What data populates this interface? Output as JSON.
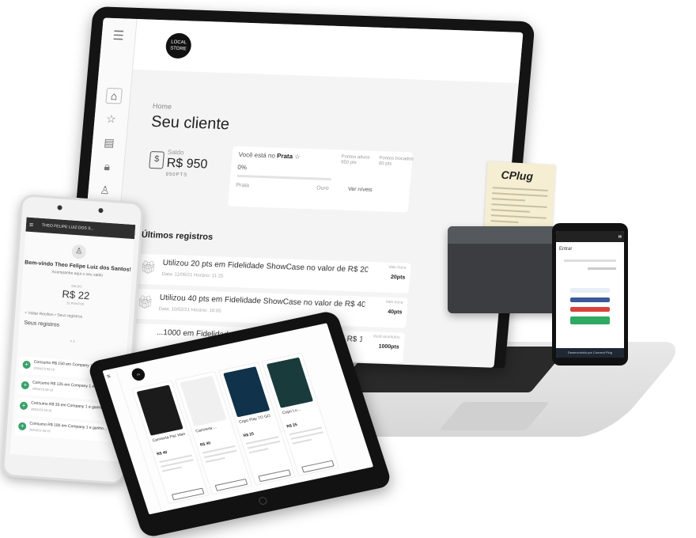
{
  "laptop": {
    "logo_line1": "LOCAL",
    "logo_line2": "STORE",
    "breadcrumb": "Home",
    "page_title": "Seu cliente",
    "balance": {
      "label": "Saldo",
      "value": "R$ 950",
      "points": "950PTS"
    },
    "tier": {
      "text_prefix": "Você está no",
      "current": "Prata",
      "progress_text": "0%",
      "progress_fraction": 0.0,
      "from": "Prata",
      "to": "Ouro",
      "points_info": "Pontos ativos\n950 pts",
      "points_used": "Pontos trocados\n00 pts",
      "link": "Ver níveis"
    },
    "section_title": "Últimos registros",
    "records": [
      {
        "desc": "Utilizou 20 pts em Fidelidade ShowCase no valor de R$ 20",
        "date": "Data: 11/06/21   Horário: 11:25",
        "kind": "Vale troca",
        "pts": "20pts"
      },
      {
        "desc": "Utilizou 40 pts em Fidelidade ShowCase no valor de R$ 40",
        "date": "Data: 10/02/21   Horário: 16:05",
        "kind": "Vale troca",
        "pts": "40pts"
      },
      {
        "desc": "...1000 em Fidelidade ShowCase e ganhou 1000 pts | R$ 1...",
        "date": "",
        "kind": "Você acumulou",
        "pts": "1000pts"
      }
    ]
  },
  "receipt": {
    "brand": "CPlug"
  },
  "phone_right": {
    "title": "Entrar",
    "footer": "Desenvolvido por Connect Plug"
  },
  "phone_left": {
    "header": "THEO FELIPE LUIZ DOS S...",
    "welcome": "Bem-vindo Theo Felipe Luiz dos Santos!",
    "subtitle": "Acompanhe aqui o seu saldo",
    "balance_label": "SALDO",
    "balance": "R$ 22",
    "points": "22 PONTOS",
    "nav": "< Voltar   Recibos  •  Seus registros",
    "section": "Seus registros",
    "pager": "‹  ›",
    "items": [
      {
        "text": "Consumo R$ 150 em Company 1 e ganho...",
        "date": "20/04/23 08:18"
      },
      {
        "text": "Consumo R$ 125 em Company 1 e ganho...",
        "date": "20/04/23 08:18"
      },
      {
        "text": "Consumo R$ 35 em Company 1 e ganho...",
        "date": "20/04/23 08:18"
      },
      {
        "text": "Consumo R$ 100 em Company 1 e ganho...",
        "date": "20/04/23 08:18"
      }
    ]
  },
  "tablet": {
    "products": [
      {
        "name": "Camiseta Pac Man",
        "price": "R$ 40",
        "color": "#1b1b1b"
      },
      {
        "name": "Camiseta ...",
        "price": "R$ 40",
        "color": "#f0f0f0"
      },
      {
        "name": "Copo Play TO GO",
        "price": "R$ 25",
        "color": "#10324a"
      },
      {
        "name": "Copo Lu...",
        "price": "R$ 25",
        "color": "#1a3b3c"
      }
    ]
  },
  "colors": {
    "accent_green": "#38a169",
    "dark": "#141414"
  }
}
